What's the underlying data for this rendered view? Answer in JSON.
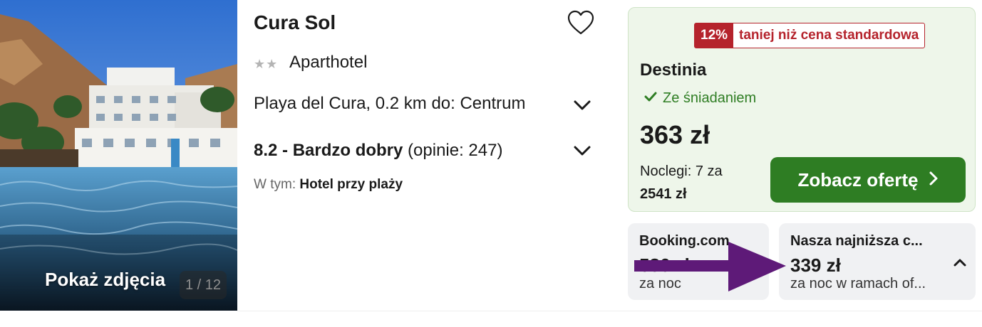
{
  "photo": {
    "show_photos_label": "Pokaż zdjęcia",
    "counter": "1 / 12"
  },
  "hotel": {
    "name": "Cura Sol",
    "stars": "★★",
    "type": "Aparthotel",
    "location": "Playa del Cura, 0.2 km do: Centrum",
    "rating_bold": "8.2 - Bardzo dobry",
    "rating_reviews": "(opinie: 247)",
    "includes_prefix": "W tym:",
    "includes_value": "Hotel przy plaży"
  },
  "deal": {
    "discount_pct": "12%",
    "discount_text": "taniej niż cena standardowa",
    "provider": "Destinia",
    "breakfast": "Ze śniadaniem",
    "price": "363 zł",
    "nights_text": "Noclegi: 7 za",
    "total": "2541 zł",
    "button_label": "Zobacz ofertę"
  },
  "alternatives": [
    {
      "name": "Booking.com",
      "price": "586 zł",
      "sub": "za noc"
    },
    {
      "name": "Nasza najniższa c...",
      "price": "339 zł",
      "sub": "za noc w ramach of..."
    }
  ],
  "colors": {
    "green": "#2e7d23",
    "red": "#b5232c",
    "arrow": "#5e1a78"
  },
  "icons": [
    "heart-icon",
    "chevron-down-icon",
    "check-icon",
    "chevron-right-icon",
    "chevron-up-icon"
  ]
}
